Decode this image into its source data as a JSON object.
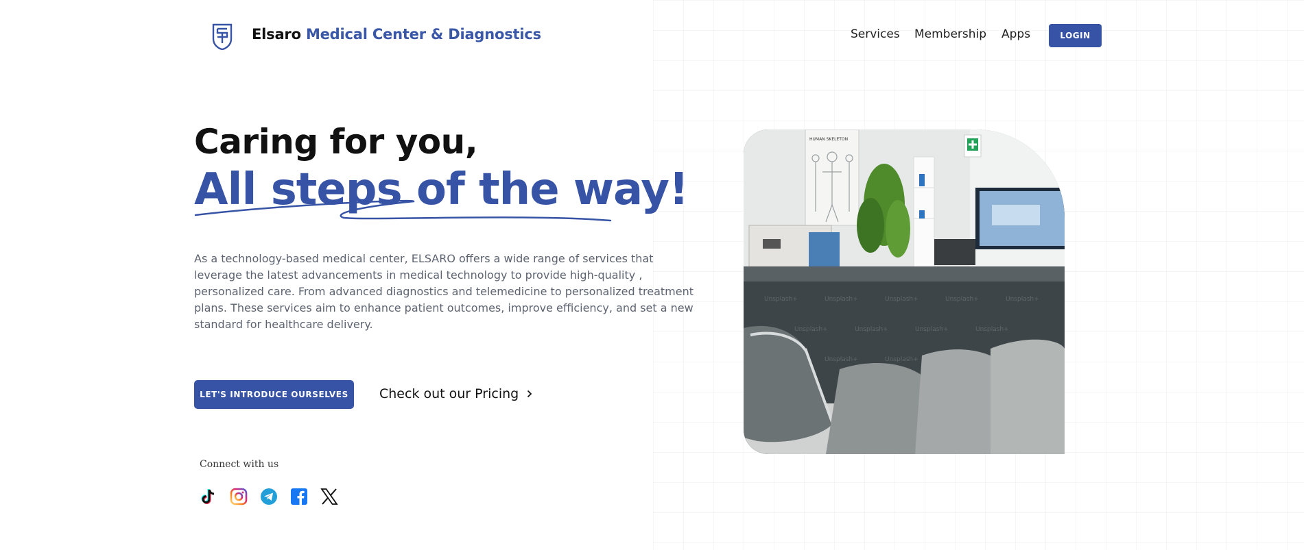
{
  "header": {
    "logo_icon": "shield-monogram-icon",
    "brand_prefix": "Elsaro",
    "brand_accent": "Medical Center & Diagnostics",
    "nav": [
      "Services",
      "Membership",
      "Apps"
    ],
    "login_label": "LOGIN"
  },
  "hero": {
    "title_line1": "Caring for you,",
    "title_line2": "All steps of the way!",
    "description": "As a technology-based medical center, ELSARO offers a wide range of services that leverage the latest advancements in medical technology to provide high-quality , personalized care. From advanced diagnostics and telemedicine to personalized treatment plans. These services aim to enhance patient outcomes, improve efficiency, and set a new standard for healthcare delivery.",
    "primary_cta": "LET'S INTRODUCE OURSELVES",
    "secondary_cta": "Check out our Pricing",
    "secondary_cta_icon": "chevron-right-icon"
  },
  "social": {
    "label": "Connect with us",
    "icons": [
      "tiktok-icon",
      "instagram-icon",
      "telegram-icon",
      "facebook-icon",
      "x-icon"
    ]
  },
  "image": {
    "subject": "clinic-waiting-room-photo",
    "watermark": "Unsplash+",
    "poster_title": "HUMAN SKELETON"
  },
  "colors": {
    "brand": "#3653a5",
    "text": "#111111",
    "muted_text": "#5d6470"
  }
}
